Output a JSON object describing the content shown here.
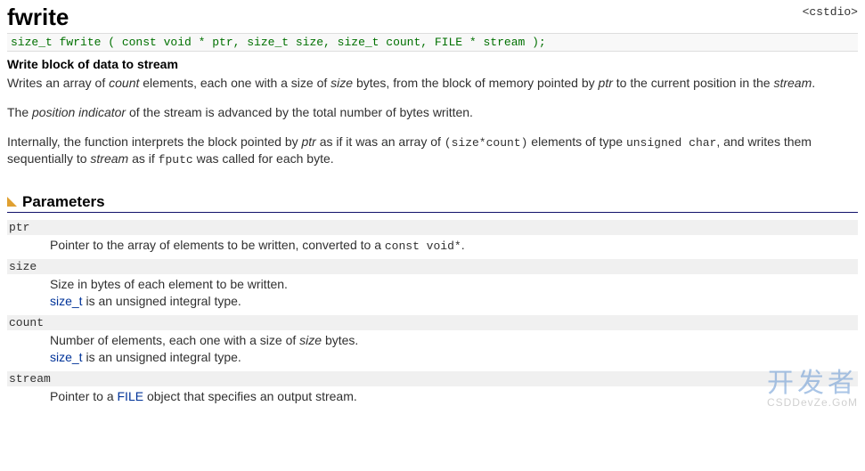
{
  "header": {
    "name": "fwrite",
    "include": "<cstdio>"
  },
  "signature": "size_t fwrite ( const void * ptr, size_t size, size_t count, FILE * stream );",
  "subtitle": "Write block of data to stream",
  "desc": {
    "p1_a": "Writes an array of ",
    "p1_count": "count",
    "p1_b": " elements, each one with a size of ",
    "p1_size": "size",
    "p1_c": " bytes, from the block of memory pointed by ",
    "p1_ptr": "ptr",
    "p1_d": " to the current position in the ",
    "p1_stream": "stream",
    "p1_e": ".",
    "p2_a": "The ",
    "p2_pi": "position indicator",
    "p2_b": " of the stream is advanced by the total number of bytes written.",
    "p3_a": "Internally, the function interprets the block pointed by ",
    "p3_ptr": "ptr",
    "p3_b": " as if it was an array of ",
    "p3_expr": "(size*count)",
    "p3_c": " elements of type ",
    "p3_uchar": "unsigned char",
    "p3_d": ", and writes them sequentially to ",
    "p3_stream": "stream",
    "p3_e": " as if ",
    "p3_fputc": "fputc",
    "p3_f": " was called for each byte."
  },
  "params_heading": "Parameters",
  "params": {
    "ptr": {
      "name": "ptr",
      "line1_a": "Pointer to the array of elements to be written, converted to a ",
      "line1_code": "const void*",
      "line1_b": "."
    },
    "size": {
      "name": "size",
      "line1": "Size in bytes of each element to be written.",
      "line2_link": "size_t",
      "line2_rest": " is an unsigned integral type."
    },
    "count": {
      "name": "count",
      "line1_a": "Number of elements, each one with a size of ",
      "line1_em": "size",
      "line1_b": " bytes.",
      "line2_link": "size_t",
      "line2_rest": " is an unsigned integral type."
    },
    "stream": {
      "name": "stream",
      "line1_a": "Pointer to a ",
      "line1_link": "FILE",
      "line1_b": " object that specifies an output stream."
    }
  },
  "watermark": {
    "big": "开发者",
    "small": "CSDDevZe.GoM"
  }
}
